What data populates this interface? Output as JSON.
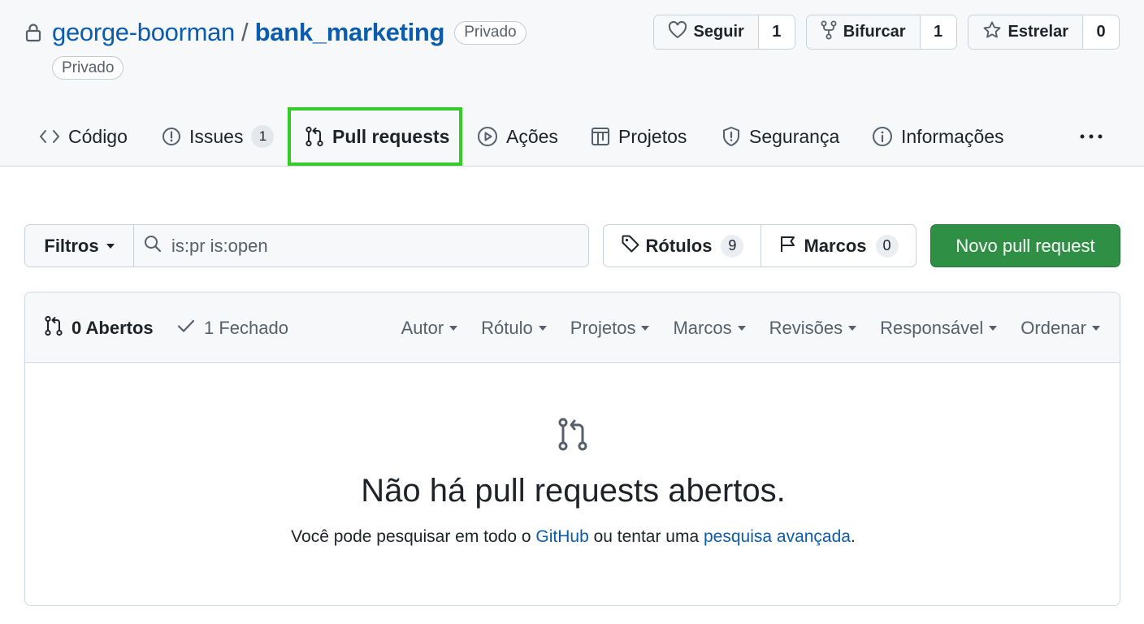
{
  "repo": {
    "owner": "george-boorman",
    "separator": "/",
    "name": "bank_marketing",
    "visibility_badge": "Privado",
    "visibility_badge_secondary": "Privado",
    "icon": "lock-icon"
  },
  "actions": {
    "watch": {
      "label": "Seguir",
      "count": "1",
      "icon": "heart-icon"
    },
    "fork": {
      "label": "Bifurcar",
      "count": "1",
      "icon": "fork-icon"
    },
    "star": {
      "label": "Estrelar",
      "count": "0",
      "icon": "star-icon"
    }
  },
  "tabs": [
    {
      "label": "Código",
      "icon": "code-icon"
    },
    {
      "label": "Issues",
      "icon": "issue-icon",
      "count": "1"
    },
    {
      "label": "Pull requests",
      "icon": "pull-request-icon",
      "active": true
    },
    {
      "label": "Ações",
      "icon": "play-icon"
    },
    {
      "label": "Projetos",
      "icon": "table-icon"
    },
    {
      "label": "Segurança",
      "icon": "shield-icon"
    },
    {
      "label": "Informações",
      "icon": "info-icon"
    }
  ],
  "tabs_more_icon": "kebab-horizontal-icon",
  "toolbar": {
    "filters_label": "Filtros",
    "search_value": "is:pr is:open",
    "labels_label": "Rótulos",
    "labels_count": "9",
    "milestones_label": "Marcos",
    "milestones_count": "0",
    "new_pr_label": "Novo pull request"
  },
  "list_header": {
    "open_label": "0 Abertos",
    "closed_label": "1 Fechado",
    "sorts": [
      "Autor",
      "Rótulo",
      "Projetos",
      "Marcos",
      "Revisões",
      "Responsável",
      "Ordenar"
    ]
  },
  "blankslate": {
    "title": "Não há pull requests abertos.",
    "text_before": "Você pode pesquisar em todo o ",
    "link_1": "GitHub",
    "text_middle": " ou tentar uma ",
    "link_2": "pesquisa avançada",
    "text_after": "."
  },
  "colors": {
    "link": "#0b5cad",
    "primary_button": "#2f8f45",
    "highlight_box": "#33cc2b",
    "header_bg": "#f6f8fa"
  }
}
